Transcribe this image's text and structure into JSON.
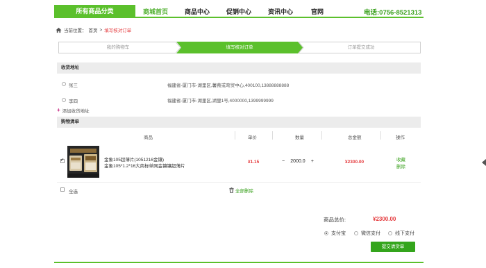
{
  "header": {
    "category_button": "所有商品分类",
    "nav": [
      {
        "label": "商城首页",
        "active": true
      },
      {
        "label": "商品中心",
        "active": false
      },
      {
        "label": "促销中心",
        "active": false
      },
      {
        "label": "资讯中心",
        "active": false
      },
      {
        "label": "官网",
        "active": false
      }
    ],
    "phone": "电话:0756-8521313"
  },
  "breadcrumb": {
    "prefix": "当前位置：",
    "home": "首页",
    "separator": ">",
    "current": "填写核对订单"
  },
  "steps": [
    {
      "label": "我的购物车",
      "state": "done"
    },
    {
      "label": "填写核对订单",
      "state": "active"
    },
    {
      "label": "订单提交成功",
      "state": "pending"
    }
  ],
  "address_section": {
    "title": "收货地址",
    "addresses": [
      {
        "name": "张三",
        "detail": "福建省-厦门市-湖里区,薯蓣或弯贸中心,400100,13888888888",
        "selected": false
      },
      {
        "name": "李四",
        "detail": "福建省-厦门市-湖里区,湖里1号,4000000,1399999999",
        "selected": false
      }
    ],
    "add_label": "添加收货地址"
  },
  "cart_section": {
    "title": "购物清单",
    "columns": [
      "商品",
      "单价",
      "数量",
      "总金额",
      "操作"
    ],
    "items": [
      {
        "checked": true,
        "name_line1": "金象105超薄片(1051216金镶)",
        "name_line2": "金象105*1.2*16大商标单网金镶镶超薄片",
        "unit_price": "¥1.15",
        "qty_minus": "−",
        "quantity": "2000.0",
        "qty_plus": "+",
        "total": "¥2300.00",
        "action_fav": "收藏",
        "action_delete": "删除"
      }
    ],
    "select_all": "全选",
    "delete_all": "全部删除"
  },
  "summary": {
    "total_label": "商品总价:",
    "total_value": "¥2300.00",
    "payment_options": [
      {
        "label": "支付宝",
        "selected": true
      },
      {
        "label": "微信支付",
        "selected": false
      },
      {
        "label": "线下支付",
        "selected": false
      }
    ],
    "submit_label": "提交请货单"
  },
  "colors": {
    "brand_green": "#5bc02c",
    "price_red": "#e4393c",
    "section_grey": "#ececec"
  }
}
